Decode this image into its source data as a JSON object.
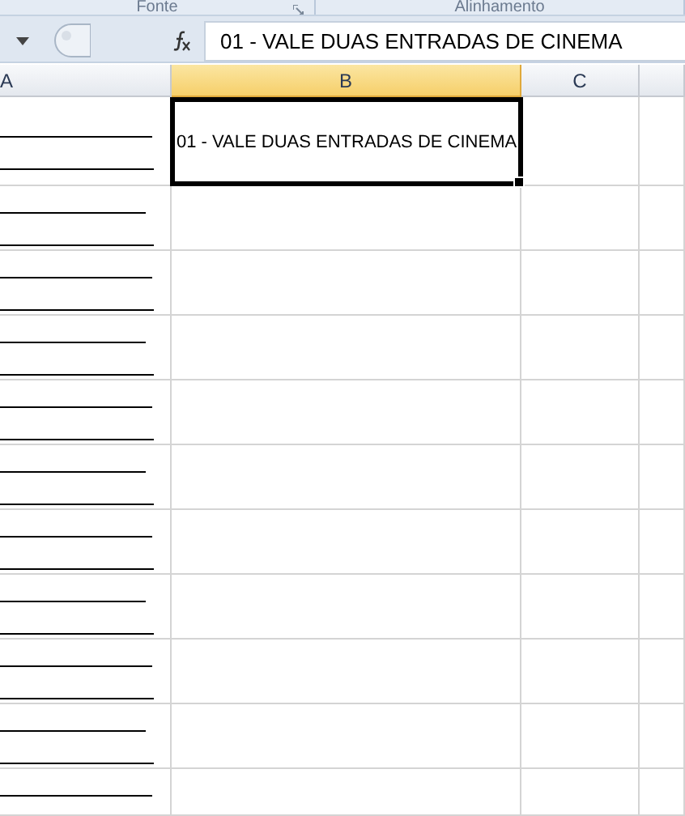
{
  "ribbon_groups": [
    {
      "label": "Fonte",
      "launcher": true
    },
    {
      "label": "Alinhamento",
      "launcher": false
    }
  ],
  "formula_bar": {
    "value": "01 - VALE DUAS ENTRADAS DE CINEMA"
  },
  "sheet": {
    "columns": [
      {
        "label": "A",
        "selected": false
      },
      {
        "label": "B",
        "selected": true
      },
      {
        "label": "C",
        "selected": false
      }
    ],
    "active_cell": {
      "value": "01 - VALE DUAS ENTRADAS DE CINEMA"
    }
  }
}
